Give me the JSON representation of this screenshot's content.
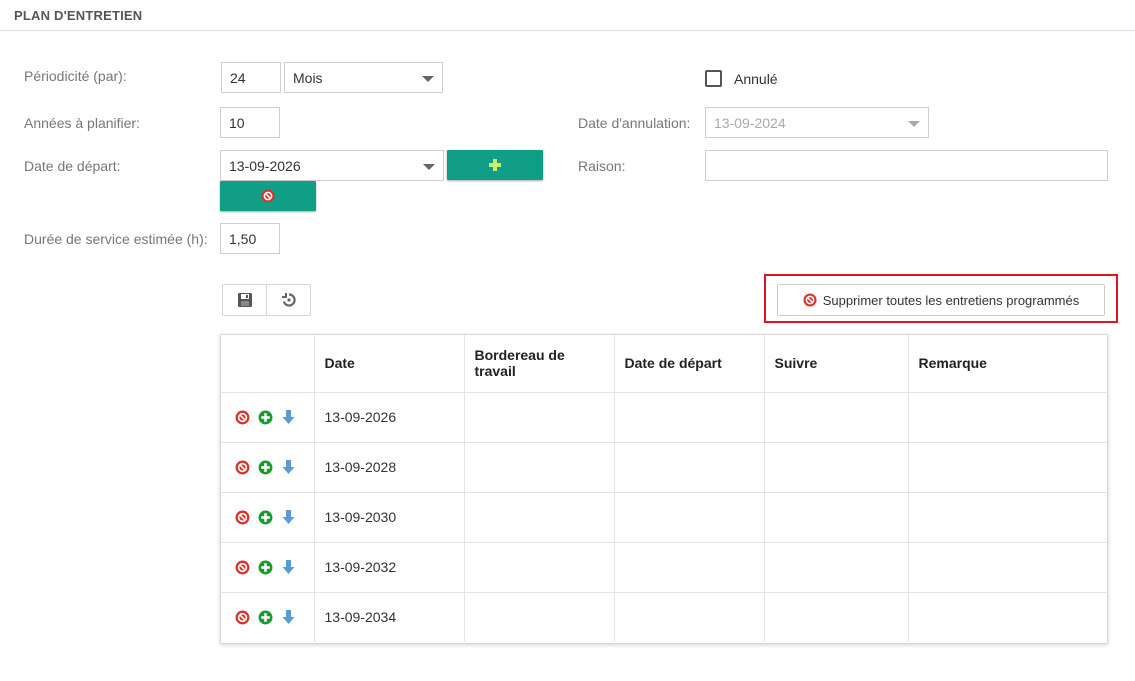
{
  "section": {
    "title": "PLAN D'ENTRETIEN"
  },
  "form": {
    "periodicity_label": "Périodicité (par):",
    "periodicity_value": "24",
    "periodicity_unit": "Mois",
    "years_label": "Années à planifier:",
    "years_value": "10",
    "start_label": "Date de départ:",
    "start_value": "13-09-2026",
    "duration_label": "Durée de service estimée (h):",
    "duration_value": "1,50",
    "cancelled_label": "Annulé",
    "cancel_date_label": "Date d'annulation:",
    "cancel_date_value": "13-09-2024",
    "reason_label": "Raison:",
    "reason_value": ""
  },
  "actions": {
    "delete_all_label": "Supprimer toutes les entretiens programmés"
  },
  "table": {
    "headers": [
      "",
      "Date",
      "Bordereau de travail",
      "Date de départ",
      "Suivre",
      "Remarque"
    ],
    "rows": [
      {
        "date": "13-09-2026",
        "work_order": "",
        "start_date": "",
        "follow": "",
        "remark": ""
      },
      {
        "date": "13-09-2028",
        "work_order": "",
        "start_date": "",
        "follow": "",
        "remark": ""
      },
      {
        "date": "13-09-2030",
        "work_order": "",
        "start_date": "",
        "follow": "",
        "remark": ""
      },
      {
        "date": "13-09-2032",
        "work_order": "",
        "start_date": "",
        "follow": "",
        "remark": ""
      },
      {
        "date": "13-09-2034",
        "work_order": "",
        "start_date": "",
        "follow": "",
        "remark": ""
      }
    ]
  },
  "icons": {
    "delete": "delete-circle-icon",
    "add": "add-circle-icon",
    "move_down": "arrow-down-icon",
    "save": "floppy-disk-icon",
    "reset": "undo-icon",
    "dropdown": "chevron-down-icon"
  },
  "colors": {
    "teal": "#119e86",
    "highlight": "#e0141e",
    "delete_red": "#d9342b",
    "add_green": "#1a9a2e",
    "arrow_blue": "#5b9bd5"
  }
}
